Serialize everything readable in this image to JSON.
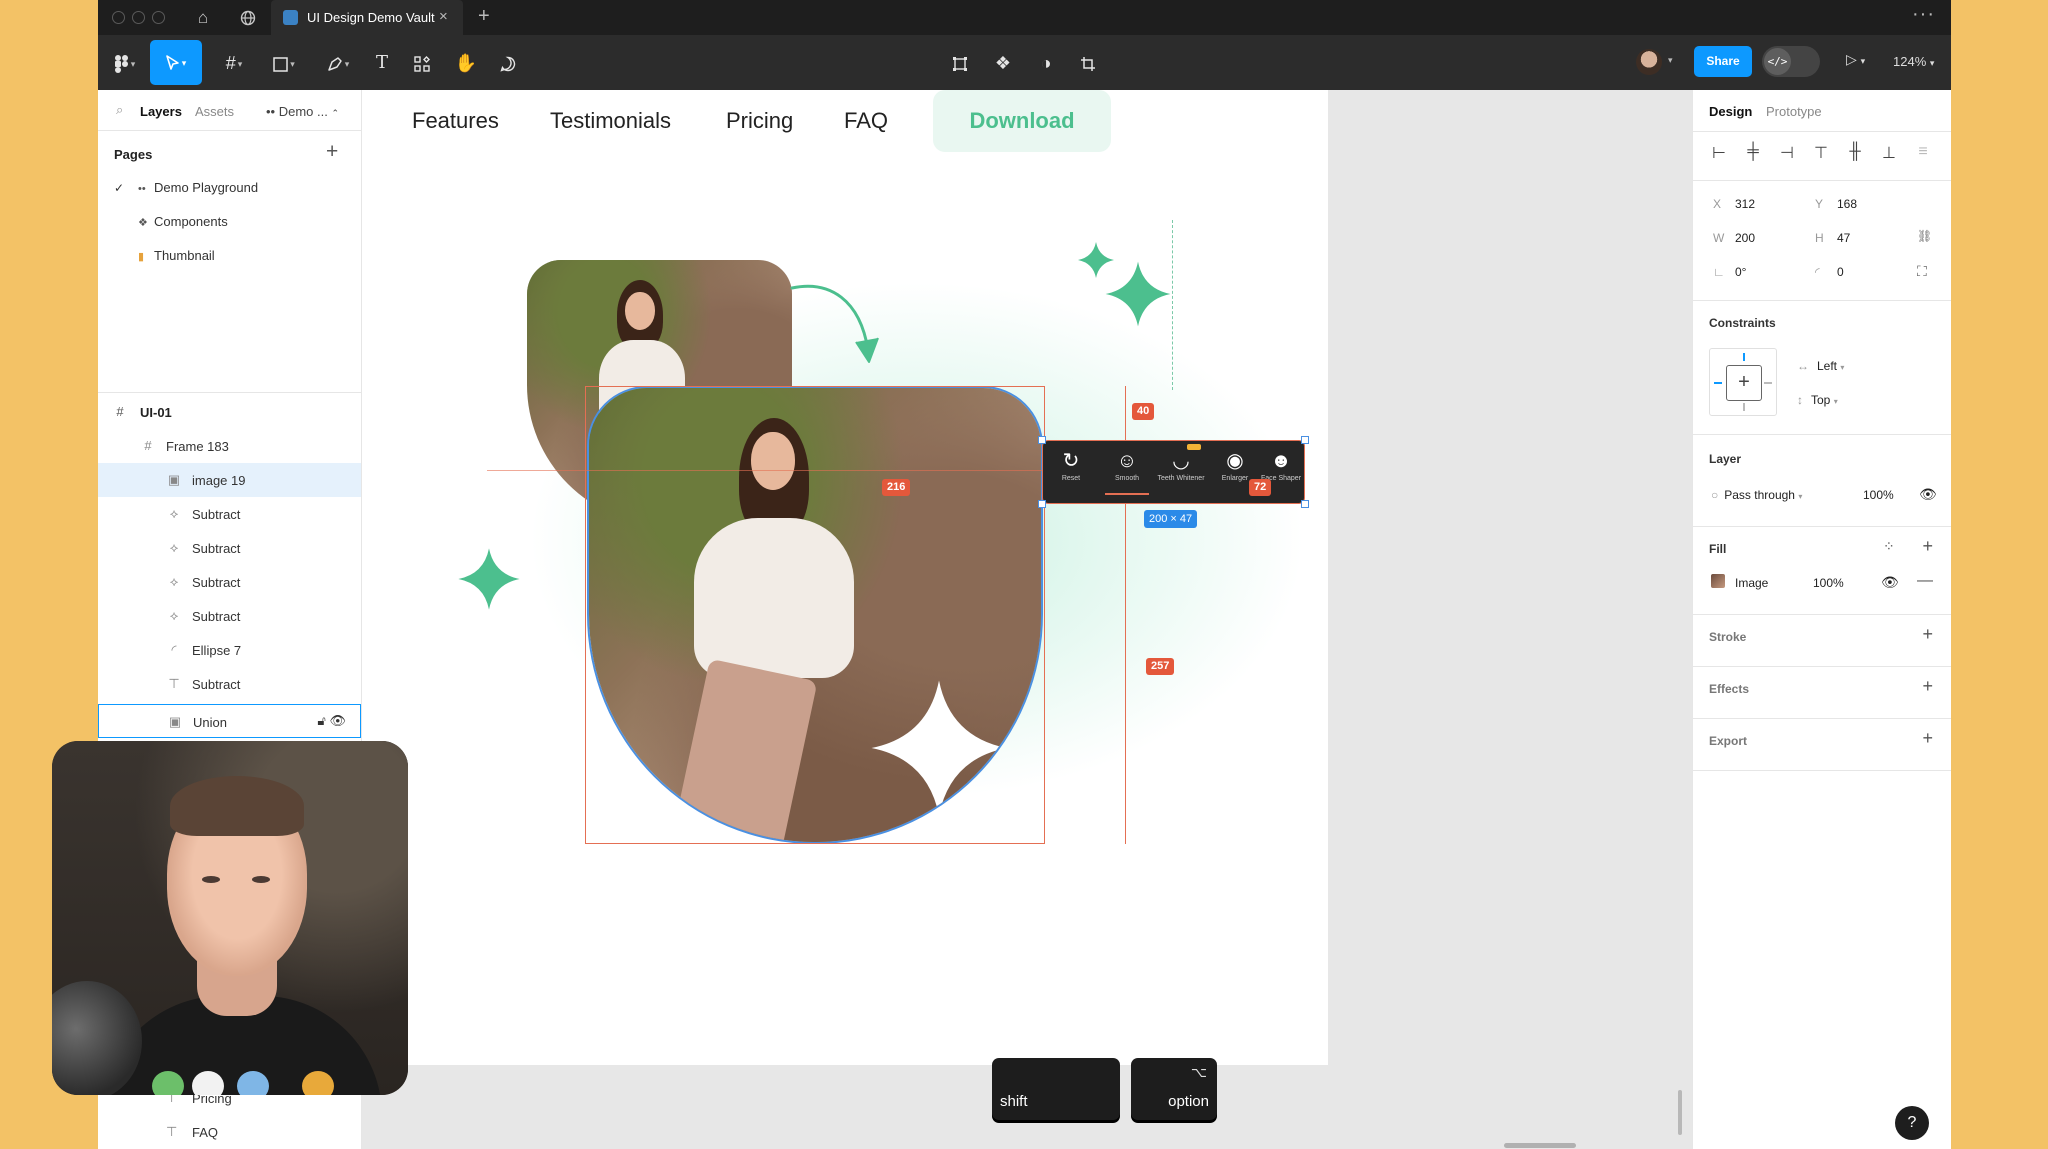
{
  "tabbar": {
    "tab_title": "UI Design Demo Vault",
    "close_glyph": "×",
    "new_tab_glyph": "+",
    "more_glyph": "···"
  },
  "toolbar": {
    "share_label": "Share",
    "dev_glyph": "</>",
    "zoom": "124%"
  },
  "left_panel": {
    "tabs": {
      "layers": "Layers",
      "assets": "Assets",
      "page_switch": "Demo ..."
    },
    "pages_heading": "Pages",
    "pages": [
      {
        "label": "Demo Playground",
        "icon": "••",
        "checked": true
      },
      {
        "label": "Components",
        "icon": "❖",
        "checked": false
      },
      {
        "label": "Thumbnail",
        "icon": "▮",
        "checked": false
      }
    ],
    "frame_label": "UI-01",
    "layers": [
      {
        "label": "Frame 183",
        "icon": "frame-icon"
      },
      {
        "label": "image 19",
        "icon": "image-icon",
        "selected": true
      },
      {
        "label": "Subtract",
        "icon": "boolean-icon"
      },
      {
        "label": "Subtract",
        "icon": "boolean-icon"
      },
      {
        "label": "Subtract",
        "icon": "boolean-icon"
      },
      {
        "label": "Subtract",
        "icon": "boolean-icon"
      },
      {
        "label": "Ellipse 7",
        "icon": "ellipse-icon"
      },
      {
        "label": "Subtract",
        "icon": "text-icon"
      },
      {
        "label": "Union",
        "icon": "image-icon"
      }
    ],
    "under_webcam_layers": [
      {
        "label": "Pricing"
      },
      {
        "label": "FAQ"
      }
    ]
  },
  "canvas": {
    "nav": {
      "features": "Features",
      "testimonials": "Testimonials",
      "pricing": "Pricing",
      "faq": "FAQ",
      "download": "Download"
    },
    "measurements": {
      "top": "40",
      "left": "216",
      "right": "72",
      "bottom": "257",
      "size": "200 × 47"
    },
    "widget": {
      "items": [
        {
          "label": "Reset",
          "icon": "reset-icon"
        },
        {
          "label": "Smooth",
          "icon": "smooth-face-icon"
        },
        {
          "label": "Teeth Whitener",
          "icon": "teeth-icon"
        },
        {
          "label": "Enlarger",
          "icon": "eye-enlarger-icon"
        },
        {
          "label": "Face Shaper",
          "icon": "face-shaper-icon"
        }
      ]
    },
    "accent_color": "#4cbf8e"
  },
  "right_panel": {
    "tabs": {
      "design": "Design",
      "prototype": "Prototype"
    },
    "position": {
      "x_label": "X",
      "x": "312",
      "y_label": "Y",
      "y": "168"
    },
    "size": {
      "w_label": "W",
      "w": "200",
      "h_label": "H",
      "h": "47"
    },
    "rotation": "0°",
    "radius": "0",
    "constraints_heading": "Constraints",
    "constraint_h": "Left",
    "constraint_v": "Top",
    "layer_heading": "Layer",
    "blend": "Pass through",
    "opacity": "100%",
    "fill_heading": "Fill",
    "fill_type": "Image",
    "fill_opacity": "100%",
    "stroke_heading": "Stroke",
    "effects_heading": "Effects",
    "export_heading": "Export",
    "help_glyph": "?"
  },
  "keys": {
    "shift": "shift",
    "option": "option",
    "option_symbol": "⌥"
  },
  "colors": {
    "figma_blue": "#0d99ff",
    "measure_red": "#e4583b",
    "download_green": "#4cbf8e",
    "background_yellow": "#f3c266"
  }
}
